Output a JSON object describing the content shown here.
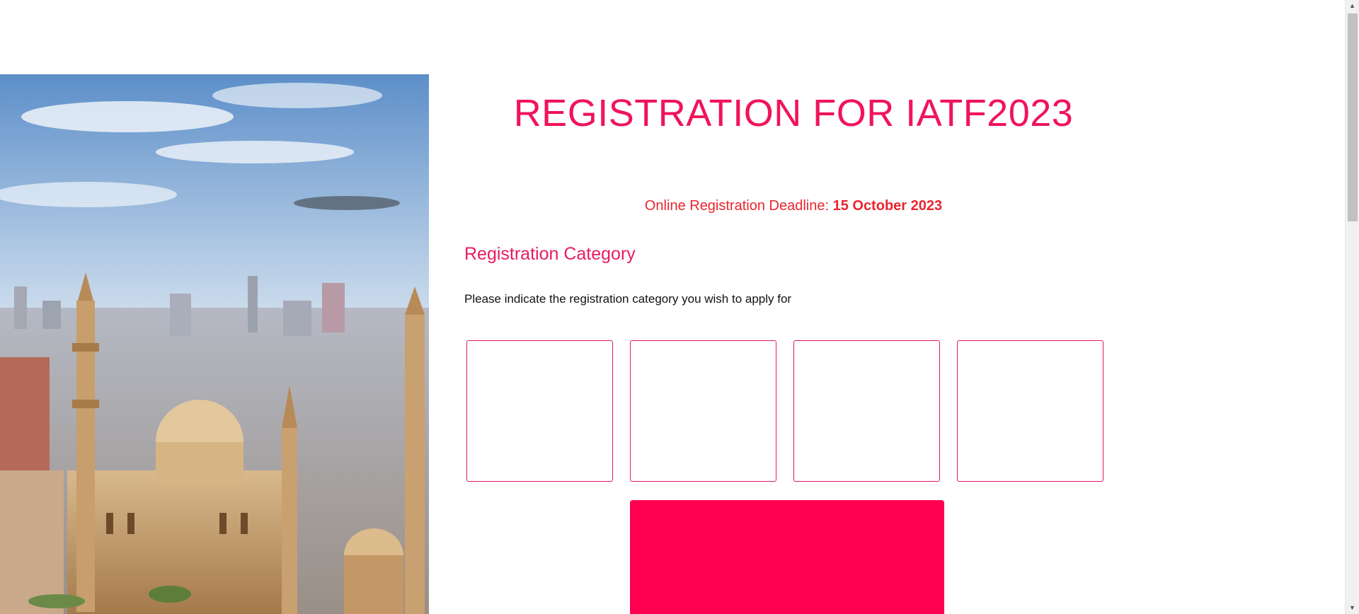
{
  "header": {
    "title": "REGISTRATION FOR IATF2023"
  },
  "deadline": {
    "label": "Online Registration Deadline: ",
    "date": "15 October 2023"
  },
  "registration": {
    "section_title": "Registration Category",
    "instructions": "Please indicate the registration category you wish to apply for",
    "category_count": 4
  },
  "colors": {
    "accent": "#f0145a",
    "deadline": "#e9262f",
    "submit": "#ff0051",
    "card_border": "#e2166a"
  },
  "hero": {
    "icon": "cairo-mosque-image"
  }
}
